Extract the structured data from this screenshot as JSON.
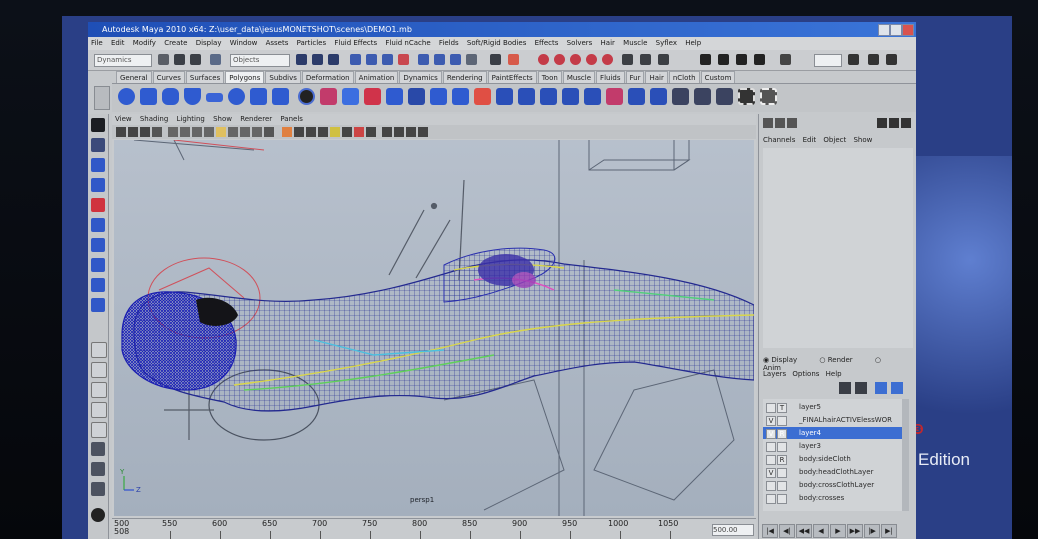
{
  "window": {
    "title": "Autodesk Maya 2010 x64: Z:\\user_data\\jesusMONETSHOT\\scenes\\DEMO1.mb"
  },
  "menubar": [
    "File",
    "Edit",
    "Modify",
    "Create",
    "Display",
    "Window",
    "Assets",
    "Particles",
    "Fluid Effects",
    "Fluid nCache",
    "Fields",
    "Soft/Rigid Bodies",
    "Effects",
    "Solvers",
    "Hair",
    "Muscle",
    "Syflex",
    "Help"
  ],
  "statusline": {
    "mode_select": "Dynamics",
    "object_field": "Objects"
  },
  "shelf_tabs": [
    "General",
    "Curves",
    "Surfaces",
    "Polygons",
    "Subdivs",
    "Deformation",
    "Animation",
    "Dynamics",
    "Rendering",
    "PaintEffects",
    "Toon",
    "Muscle",
    "Fluids",
    "Fur",
    "Hair",
    "nCloth",
    "Custom"
  ],
  "shelf_active": "Polygons",
  "panel": {
    "menu": [
      "View",
      "Shading",
      "Lighting",
      "Show",
      "Renderer",
      "Panels"
    ],
    "camera_label": "persp1"
  },
  "channel_box": {
    "menu": [
      "Channels",
      "Edit",
      "Object",
      "Show"
    ]
  },
  "layer_editor": {
    "tabs": [
      "Display",
      "Render",
      "Anim"
    ],
    "active_tab": "Display",
    "menu": [
      "Layers",
      "Options",
      "Help"
    ],
    "layers": [
      {
        "name": "layer5",
        "v": "",
        "r": "T"
      },
      {
        "name": "_FINALhairACTIVElessWOR",
        "v": "V",
        "r": ""
      },
      {
        "name": "layer4",
        "v": "V",
        "r": "R",
        "selected": true
      },
      {
        "name": "layer3",
        "v": "",
        "r": ""
      },
      {
        "name": "body:sideCloth",
        "v": "",
        "r": "R"
      },
      {
        "name": "body:headClothLayer",
        "v": "V",
        "r": ""
      },
      {
        "name": "body:crossClothLayer",
        "v": "",
        "r": ""
      },
      {
        "name": "body:crosses",
        "v": "",
        "r": ""
      }
    ]
  },
  "timeline": {
    "start": "500",
    "start_sub": "508",
    "ticks": [
      "550",
      "600",
      "650",
      "700",
      "750",
      "800",
      "850",
      "900",
      "950",
      "1000",
      "1050"
    ],
    "range_field": "500.00"
  },
  "overlay_text": {
    "edition": "Edition"
  },
  "colors": {
    "title_bar": "#1f4fb6",
    "ui_gray": "#c6c9cc",
    "viewport": "#b7c0cc",
    "wire_blue": "#2a2fae",
    "selected_layer": "#3c6ed2",
    "desktop": "#2a3f86"
  }
}
